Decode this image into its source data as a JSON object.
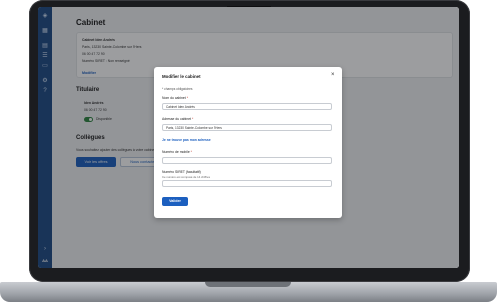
{
  "sidebar": {
    "items": [
      {
        "icon": "shield-logo-icon",
        "glyph": "◈"
      },
      {
        "icon": "grid-icon",
        "glyph": "▦"
      },
      {
        "icon": "calendar-icon",
        "glyph": "▤"
      },
      {
        "icon": "list-icon",
        "glyph": "☰"
      },
      {
        "icon": "document-icon",
        "glyph": "▭"
      },
      {
        "icon": "settings-icon",
        "glyph": "⚙"
      },
      {
        "icon": "help-icon",
        "glyph": "?"
      },
      {
        "icon": "collapse-icon",
        "glyph": "›"
      }
    ],
    "avatar": "AA"
  },
  "page": {
    "title": "Cabinet",
    "cabinet": {
      "name": "Cabinet Iden Andrés",
      "address": "Paris, 13230 Sainte-Colombe sur l'Hers",
      "phone": "06 00 47 72 90",
      "siret": "Numéro SIRET : Non renseigné",
      "edit_link": "Modifier"
    },
    "titulaire": {
      "section_title": "Titulaire",
      "name": "Iden Andrés",
      "phone": "06 00 47 72 90",
      "status": "Disponible"
    },
    "collegues": {
      "section_title": "Collègues",
      "description": "Vous souhaitez ajouter des collègues à votre cabinet ?",
      "primary_button": "Voir les offres",
      "secondary_button": "Nous contacter"
    }
  },
  "modal": {
    "title": "Modifier le cabinet",
    "close_glyph": "×",
    "required_note": "* champs obligatoires",
    "fields": {
      "name": {
        "label": "Nom du cabinet",
        "required": "*",
        "value": "Cabinet Iden Andrés"
      },
      "address": {
        "label": "Adresse du cabinet",
        "required": "*",
        "value": "Paris, 13230 Sainte-Colombe sur l'Hers"
      },
      "mobile": {
        "label": "Numéro de mobile",
        "required": "*",
        "value": ""
      },
      "siret": {
        "label": "Numéro SIRET (facultatif)",
        "hint": "Ce numéro est composé de 14 chiffres",
        "value": ""
      }
    },
    "address_link": "Je ne trouve pas mon adresse",
    "submit_button": "Valider"
  },
  "colors": {
    "sidebar": "#1e4a86",
    "primary": "#1c5fbf",
    "toggle_on": "#2e8540"
  }
}
